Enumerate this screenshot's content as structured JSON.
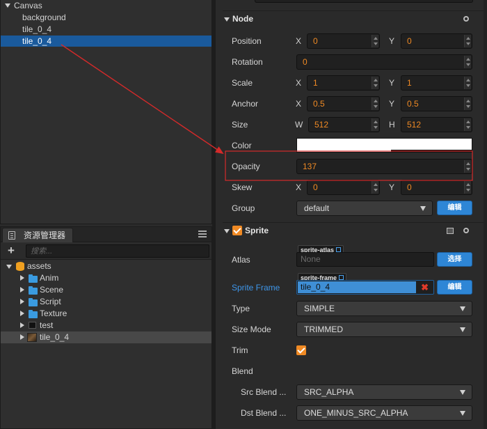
{
  "hierarchy": {
    "items": [
      {
        "label": "Canvas"
      },
      {
        "label": "background"
      },
      {
        "label": "tile_0_4"
      },
      {
        "label": "tile_0_4"
      }
    ]
  },
  "assets": {
    "tab_label": "资源管理器",
    "plus": "+",
    "search_placeholder": "搜索...",
    "items": [
      {
        "label": "assets"
      },
      {
        "label": "Anim"
      },
      {
        "label": "Scene"
      },
      {
        "label": "Script"
      },
      {
        "label": "Texture"
      },
      {
        "label": "test"
      },
      {
        "label": "tile_0_4"
      }
    ]
  },
  "inspector": {
    "node": {
      "title": "Node",
      "position": {
        "label": "Position",
        "x_label": "X",
        "x": "0",
        "y_label": "Y",
        "y": "0"
      },
      "rotation": {
        "label": "Rotation",
        "value": "0"
      },
      "scale": {
        "label": "Scale",
        "x_label": "X",
        "x": "1",
        "y_label": "Y",
        "y": "1"
      },
      "anchor": {
        "label": "Anchor",
        "x_label": "X",
        "x": "0.5",
        "y_label": "Y",
        "y": "0.5"
      },
      "size": {
        "label": "Size",
        "w_label": "W",
        "w": "512",
        "h_label": "H",
        "h": "512"
      },
      "color": {
        "label": "Color",
        "value": "#ffffff"
      },
      "opacity": {
        "label": "Opacity",
        "value": "137"
      },
      "skew": {
        "label": "Skew",
        "x_label": "X",
        "x": "0",
        "y_label": "Y",
        "y": "0"
      },
      "group": {
        "label": "Group",
        "value": "default",
        "edit_button": "编辑"
      }
    },
    "sprite": {
      "title": "Sprite",
      "atlas": {
        "label": "Atlas",
        "tag": "sprite-atlas",
        "value": "None",
        "button": "选择"
      },
      "sprite_frame": {
        "label": "Sprite Frame",
        "tag": "sprite-frame",
        "value": "tile_0_4",
        "button": "编辑"
      },
      "type": {
        "label": "Type",
        "value": "SIMPLE"
      },
      "size_mode": {
        "label": "Size Mode",
        "value": "TRIMMED"
      },
      "trim": {
        "label": "Trim"
      },
      "blend": {
        "label": "Blend"
      },
      "src_blend": {
        "label": "Src Blend ...",
        "value": "SRC_ALPHA"
      },
      "dst_blend": {
        "label": "Dst Blend ...",
        "value": "ONE_MINUS_SRC_ALPHA"
      }
    }
  },
  "colors": {
    "accent": "#f08a24",
    "selection": "#1a5a9c",
    "link": "#3e96ea",
    "annotation": "#d42a2a"
  }
}
